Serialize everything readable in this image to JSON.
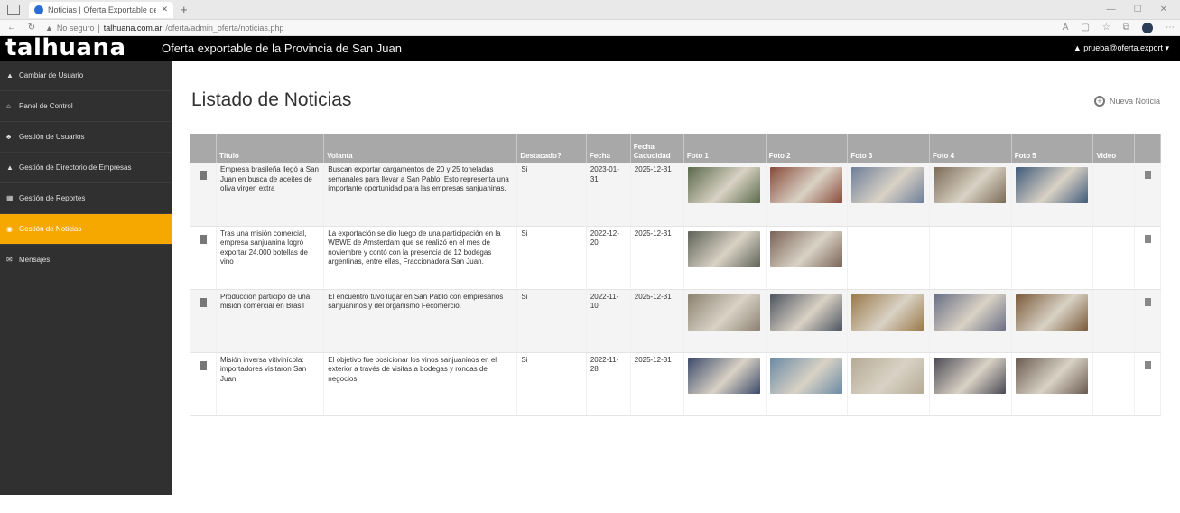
{
  "browser": {
    "tab_title": "Noticias | Oferta Exportable de ...",
    "address_prefix": "No seguro",
    "address_host": "talhuana.com.ar",
    "address_path": "/oferta/admin_oferta/noticias.php"
  },
  "header": {
    "logo": "talhuana",
    "title": "Oferta exportable de la Provincia de San Juan",
    "user": "prueba@oferta.export ▾"
  },
  "sidebar": {
    "items": [
      {
        "label": "Cambiar de Usuario",
        "icon": "user-icon",
        "glyph": "▲"
      },
      {
        "label": "Panel de Control",
        "icon": "home-icon",
        "glyph": "⌂"
      },
      {
        "label": "Gestión de Usuarios",
        "icon": "users-icon",
        "glyph": "♣"
      },
      {
        "label": "Gestión de Directorio de Empresas",
        "icon": "building-icon",
        "glyph": "▲"
      },
      {
        "label": "Gestión de Reportes",
        "icon": "table-icon",
        "glyph": "▦"
      },
      {
        "label": "Gestión de Noticias",
        "icon": "news-icon",
        "glyph": "◉",
        "active": true
      },
      {
        "label": "Mensajes",
        "icon": "envelope-icon",
        "glyph": "✉"
      }
    ]
  },
  "main": {
    "title": "Listado de Noticias",
    "new_button": "Nueva Noticia",
    "columns": [
      "",
      "Título",
      "Volanta",
      "Destacado?",
      "Fecha",
      "Fecha Caducidad",
      "Foto 1",
      "Foto 2",
      "Foto 3",
      "Foto 4",
      "Foto 5",
      "Video",
      ""
    ],
    "rows": [
      {
        "titulo": "Empresa brasileña llegó a San Juan en busca de aceites de oliva virgen extra",
        "volanta": "Buscan exportar cargamentos de 20 y 25 toneladas semanales para llevar a San Pablo. Esto representa una importante oportunidad para las empresas sanjuaninas.",
        "destacado": "Si",
        "fecha": "2023-01-31",
        "caducidad": "2025-12-31",
        "fotos": [
          "#5b6a4a",
          "#8a4a3a",
          "#6f7f9a",
          "#7a6a55",
          "#3f5a7a"
        ],
        "video": ""
      },
      {
        "titulo": "Tras una misión comercial, empresa sanjuanina logró exportar 24.000 botellas de vino",
        "volanta": "La exportación se dio luego de una participación en la WBWE de Amsterdam que se realizó en el mes de noviembre y contó con la presencia de 12 bodegas argentinas, entre ellas, Fraccionadora San Juan.",
        "destacado": "Si",
        "fecha": "2022-12-20",
        "caducidad": "2025-12-31",
        "fotos": [
          "#5f6358",
          "#7a6358"
        ],
        "video": ""
      },
      {
        "titulo": "Producción participó de una misión comercial en Brasil",
        "volanta": "El encuentro tuvo lugar en San Pablo con empresarios sanjuaninos y del organismo Fecomercio.",
        "destacado": "Si",
        "fecha": "2022-11-10",
        "caducidad": "2025-12-31",
        "fotos": [
          "#8c8272",
          "#4e5560",
          "#9a7a4a",
          "#6a6f85",
          "#7a5a3a"
        ],
        "video": ""
      },
      {
        "titulo": "Misión inversa vitivinícola: importadores visitaron San Juan",
        "volanta": "El objetivo fue posicionar los vinos sanjuaninos en el exterior a través de visitas a bodegas y rondas de negocios.",
        "destacado": "Si",
        "fecha": "2022-11-28",
        "caducidad": "2025-12-31",
        "fotos": [
          "#3b4a6a",
          "#6a8aa5",
          "#b5aa95",
          "#4a4a55",
          "#6a5a50"
        ],
        "video": ""
      }
    ]
  }
}
